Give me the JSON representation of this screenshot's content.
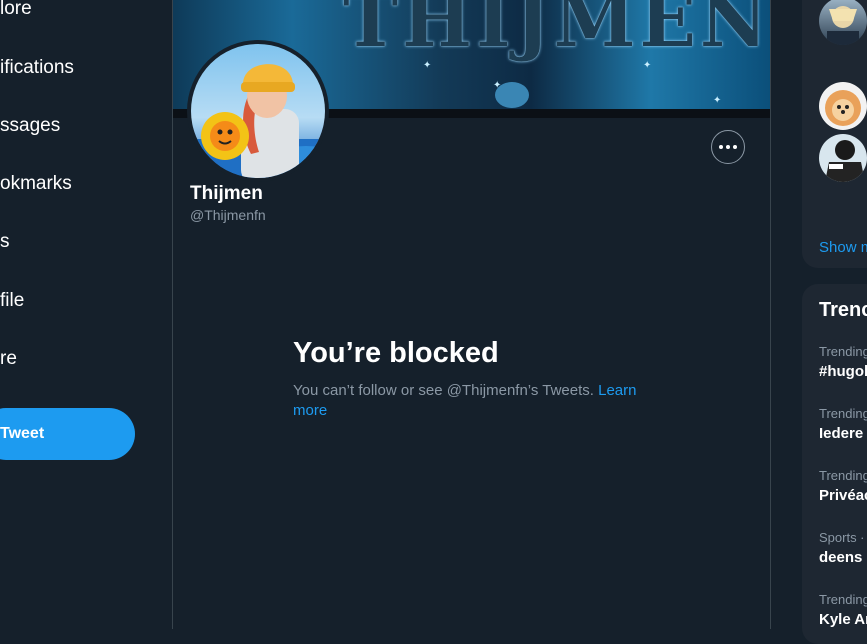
{
  "nav": {
    "items": [
      {
        "label": "lore"
      },
      {
        "label": "ifications"
      },
      {
        "label": "ssages"
      },
      {
        "label": "okmarks"
      },
      {
        "label": "s"
      },
      {
        "label": "file"
      },
      {
        "label": "re"
      }
    ],
    "tweet_label": "Tweet"
  },
  "profile": {
    "display_name": "Thijmen",
    "handle": "@Thijmenfn",
    "banner_text": "THIJMEN"
  },
  "blocked": {
    "title": "You’re blocked",
    "message": "You can’t follow or see @Thijmenfn’s Tweets.",
    "link_label": "Learn more"
  },
  "who_to_follow": {
    "show_more_label": "Show m"
  },
  "trends": {
    "title": "Trenc",
    "items": [
      {
        "meta": "Trending",
        "name": "#hugob"
      },
      {
        "meta": "Trending",
        "name": "Iedere"
      },
      {
        "meta": "Trending",
        "name": "Privéac"
      },
      {
        "meta": "Sports ·",
        "name": "deens"
      },
      {
        "meta": "Trending",
        "name": "Kyle Ar"
      }
    ]
  },
  "colors": {
    "background": "#15202b",
    "accent": "#1d9bf0",
    "secondary_text": "#8b98a5",
    "border": "#38444d",
    "card": "#1e2732"
  }
}
